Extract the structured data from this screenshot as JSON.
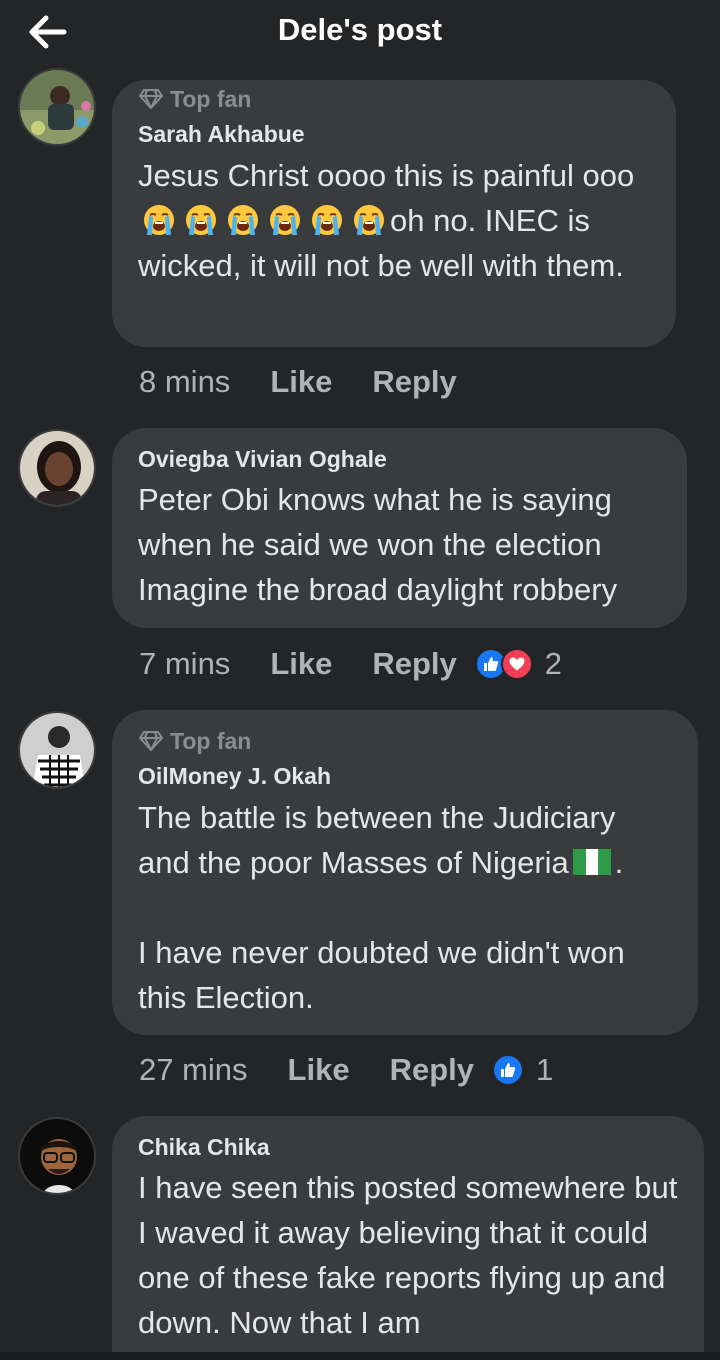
{
  "header": {
    "title": "Dele's post",
    "back_icon": "arrow-left-icon"
  },
  "colors": {
    "background": "#242527",
    "bubble": "#3a3b3c",
    "like_blue": "#1877f2",
    "love_red": "#f33e58"
  },
  "comments": [
    {
      "badge": "Top fan",
      "author": "Sarah Akhabue",
      "text_parts": [
        "Jesus Christ oooo this is painful ooo",
        "oh no.  INEC is wicked, it will not be well with them."
      ],
      "emoji": "loudly-crying-face",
      "emoji_count": 6,
      "time": "8 mins",
      "like": "Like",
      "reply": "Reply"
    },
    {
      "author": "Oviegba Vivian Oghale",
      "text": "Peter Obi knows what he is saying when he said we won the election Imagine the broad daylight robbery",
      "time": "7 mins",
      "like": "Like",
      "reply": "Reply",
      "reactions": [
        "like",
        "love"
      ],
      "reaction_count": "2"
    },
    {
      "badge": "Top fan",
      "author": "OilMoney J. Okah",
      "text_line1": "The battle is between the Judiciary and the poor Masses of Nigeria",
      "flag": "nigeria-flag",
      "text_line1_end": ".",
      "text_line2": "I have never doubted we didn't won this Election.",
      "time": "27 mins",
      "like": "Like",
      "reply": "Reply",
      "reactions": [
        "like"
      ],
      "reaction_count": "1"
    },
    {
      "author": "Chika Chika",
      "text": "I have seen this posted somewhere but I waved it away believing that it could one of these fake reports flying up and down. Now that I am"
    }
  ]
}
